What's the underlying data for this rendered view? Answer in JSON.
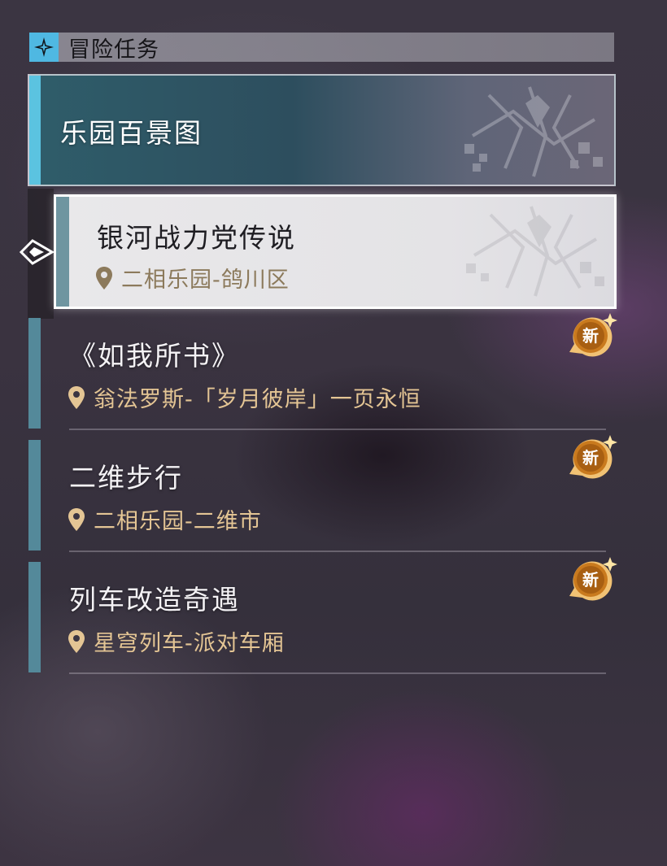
{
  "header": {
    "title": "冒险任务",
    "icon": "sparkle-icon",
    "accent_color": "#4fb8e2"
  },
  "featured": {
    "title": "乐园百景图"
  },
  "selected": {
    "title": "银河战力党传说",
    "location": "二相乐园-鸽川区"
  },
  "quests": [
    {
      "title": "《如我所书》",
      "location": "翁法罗斯-「岁月彼岸」一页永恒",
      "badge": "新"
    },
    {
      "title": "二维步行",
      "location": "二相乐园-二维市",
      "badge": "新"
    },
    {
      "title": "列车改造奇遇",
      "location": "星穹列车-派对车厢",
      "badge": "新"
    }
  ],
  "colors": {
    "location_gold": "#e4c594",
    "badge_orange": "#c97a1e",
    "item_accent": "#54899a"
  }
}
